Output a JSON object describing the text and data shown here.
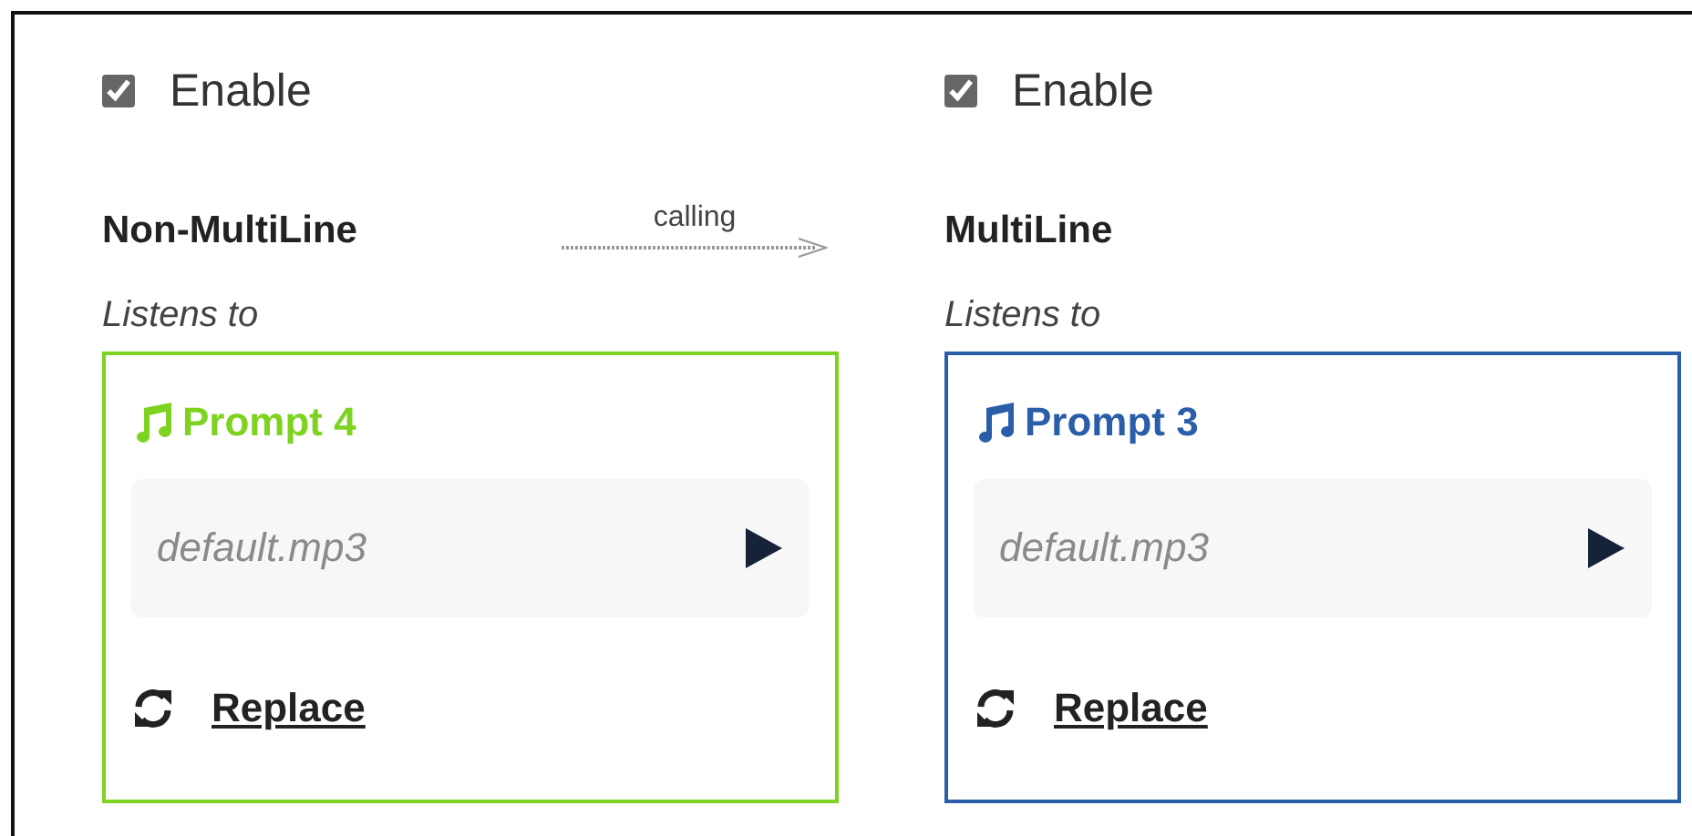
{
  "connector": {
    "label": "calling"
  },
  "columns": [
    {
      "enable": {
        "label": "Enable",
        "checked": true
      },
      "heading": "Non-MultiLine",
      "listens_label": "Listens to",
      "prompt": {
        "title": "Prompt 4",
        "color": "#7ed321",
        "placeholder": "default.mp3",
        "replace_label": "Replace"
      }
    },
    {
      "enable": {
        "label": "Enable",
        "checked": true
      },
      "heading": "MultiLine",
      "listens_label": "Listens to",
      "prompt": {
        "title": "Prompt 3",
        "color": "#2a5ea8",
        "placeholder": "default.mp3",
        "replace_label": "Replace"
      }
    }
  ]
}
